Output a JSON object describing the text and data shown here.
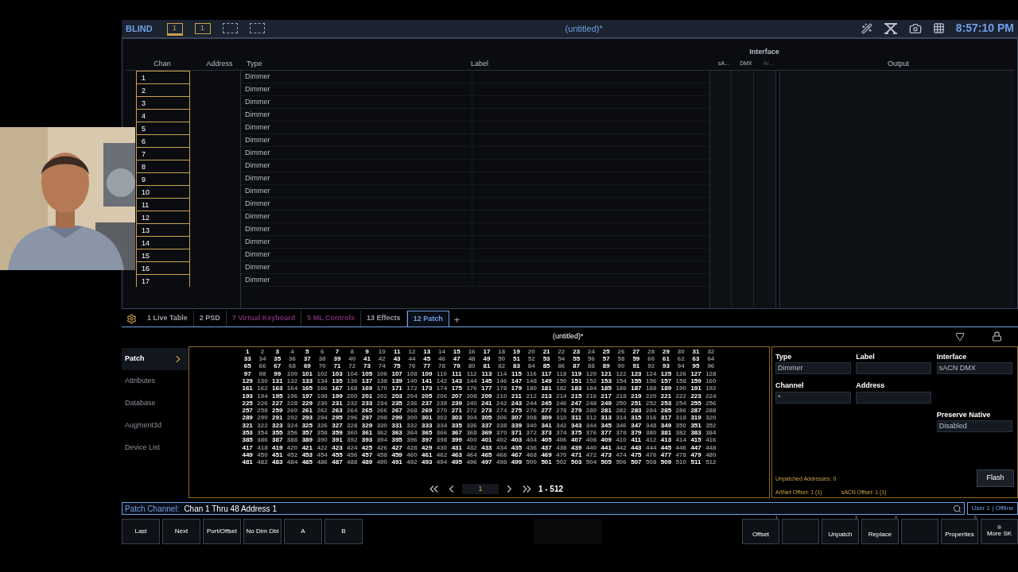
{
  "header": {
    "mode": "BLIND",
    "screens": [
      {
        "kind": "monitor",
        "label": "1"
      },
      {
        "kind": "box",
        "label": "1"
      },
      {
        "kind": "empty"
      },
      {
        "kind": "empty"
      }
    ],
    "title": "(untitled)*",
    "time": "8:57:10 PM"
  },
  "channel_table": {
    "interface_heading": "Interface",
    "columns": {
      "chan": "Chan",
      "address": "Address",
      "type": "Type",
      "label": "Label",
      "interface": [
        "sA...",
        "DMX",
        "Ar..."
      ],
      "output": "Output"
    },
    "rows": [
      {
        "chan": "1",
        "type": "Dimmer"
      },
      {
        "chan": "2",
        "type": "Dimmer"
      },
      {
        "chan": "3",
        "type": "Dimmer"
      },
      {
        "chan": "4",
        "type": "Dimmer"
      },
      {
        "chan": "5",
        "type": "Dimmer"
      },
      {
        "chan": "6",
        "type": "Dimmer"
      },
      {
        "chan": "7",
        "type": "Dimmer"
      },
      {
        "chan": "8",
        "type": "Dimmer"
      },
      {
        "chan": "9",
        "type": "Dimmer"
      },
      {
        "chan": "10",
        "type": "Dimmer"
      },
      {
        "chan": "11",
        "type": "Dimmer"
      },
      {
        "chan": "12",
        "type": "Dimmer"
      },
      {
        "chan": "13",
        "type": "Dimmer"
      },
      {
        "chan": "14",
        "type": "Dimmer"
      },
      {
        "chan": "15",
        "type": "Dimmer"
      },
      {
        "chan": "16",
        "type": "Dimmer"
      },
      {
        "chan": "17",
        "type": "Dimmer"
      }
    ]
  },
  "tabs": [
    {
      "label": "1 Live Table",
      "selected": false,
      "color": "#9aa0a8"
    },
    {
      "label": "2 PSD",
      "selected": false,
      "color": "#9aa0a8"
    },
    {
      "label": "7 Virtual Keyboard",
      "selected": false,
      "color": "#7a2f72"
    },
    {
      "label": "5 ML Controls",
      "selected": false,
      "color": "#7a2f72"
    },
    {
      "label": "13 Effects",
      "selected": false,
      "color": "#9aa0a8"
    },
    {
      "label": "12 Patch",
      "selected": true,
      "color": "#6ea0e6"
    }
  ],
  "add_tab": "+",
  "patch_title": "(untitled)*",
  "sidebar": [
    {
      "label": "Patch",
      "selected": true
    },
    {
      "label": "Attributes",
      "selected": false
    },
    {
      "label": "Database",
      "selected": false
    },
    {
      "label": "Augment3d",
      "selected": false
    },
    {
      "label": "Device List",
      "selected": false
    }
  ],
  "addresses": [
    [
      {
        "n": "1",
        "patched": true
      },
      {
        "n": "2",
        "patched": false
      },
      {
        "n": "3",
        "patched": true
      },
      {
        "n": "4",
        "patched": false
      },
      {
        "n": "5",
        "patched": true
      },
      {
        "n": "6",
        "patched": false
      },
      {
        "n": "7",
        "patched": true
      },
      {
        "n": "8",
        "patched": false
      },
      {
        "n": "9",
        "patched": true
      },
      {
        "n": "10",
        "patched": false
      },
      {
        "n": "11",
        "patched": true
      },
      {
        "n": "12",
        "patched": false
      },
      {
        "n": "13",
        "patched": true
      },
      {
        "n": "14",
        "patched": false
      },
      {
        "n": "15",
        "patched": true
      },
      {
        "n": "16",
        "patched": false
      },
      {
        "n": "17",
        "patched": true
      },
      {
        "n": "18",
        "patched": false
      },
      {
        "n": "19",
        "patched": true
      },
      {
        "n": "20",
        "patched": false
      },
      {
        "n": "21",
        "patched": true
      },
      {
        "n": "22",
        "patched": false
      },
      {
        "n": "23",
        "patched": true
      },
      {
        "n": "24",
        "patched": false
      },
      {
        "n": "25",
        "patched": true
      },
      {
        "n": "26",
        "patched": false
      },
      {
        "n": "27",
        "patched": true
      },
      {
        "n": "28",
        "patched": false
      },
      {
        "n": "29",
        "patched": true
      },
      {
        "n": "30",
        "patched": false
      },
      {
        "n": "31",
        "patched": true
      },
      {
        "n": "32",
        "patched": false
      }
    ],
    [
      {
        "n": "33",
        "patched": true
      },
      {
        "n": "34",
        "patched": false
      },
      {
        "n": "35",
        "patched": true
      },
      {
        "n": "36",
        "patched": false
      },
      {
        "n": "37",
        "patched": true
      },
      {
        "n": "38",
        "patched": false
      },
      {
        "n": "39",
        "patched": true
      },
      {
        "n": "40",
        "patched": false
      },
      {
        "n": "41",
        "patched": true
      },
      {
        "n": "42",
        "patched": false
      },
      {
        "n": "43",
        "patched": true
      },
      {
        "n": "44",
        "patched": false
      },
      {
        "n": "45",
        "patched": true
      },
      {
        "n": "46",
        "patched": false
      },
      {
        "n": "47",
        "patched": true
      },
      {
        "n": "48",
        "patched": false
      },
      {
        "n": "49",
        "patched": true
      },
      {
        "n": "50",
        "patched": false
      },
      {
        "n": "51",
        "patched": true
      },
      {
        "n": "52",
        "patched": false
      },
      {
        "n": "53",
        "patched": true
      },
      {
        "n": "54",
        "patched": false
      },
      {
        "n": "55",
        "patched": true
      },
      {
        "n": "56",
        "patched": false
      },
      {
        "n": "57",
        "patched": true
      },
      {
        "n": "58",
        "patched": false
      },
      {
        "n": "59",
        "patched": true
      },
      {
        "n": "60",
        "patched": false
      },
      {
        "n": "61",
        "patched": true
      },
      {
        "n": "62",
        "patched": false
      },
      {
        "n": "63",
        "patched": true
      },
      {
        "n": "64",
        "patched": false
      }
    ],
    [
      {
        "n": "65",
        "patched": true
      },
      {
        "n": "66",
        "patched": false
      },
      {
        "n": "67",
        "patched": true
      },
      {
        "n": "68",
        "patched": false
      },
      {
        "n": "69",
        "patched": true
      },
      {
        "n": "70",
        "patched": false
      },
      {
        "n": "71",
        "patched": true
      },
      {
        "n": "72",
        "patched": false
      },
      {
        "n": "73",
        "patched": true
      },
      {
        "n": "74",
        "patched": false
      },
      {
        "n": "75",
        "patched": true
      },
      {
        "n": "76",
        "patched": false
      },
      {
        "n": "77",
        "patched": true
      },
      {
        "n": "78",
        "patched": false
      },
      {
        "n": "79",
        "patched": true
      },
      {
        "n": "80",
        "patched": false
      },
      {
        "n": "81",
        "patched": true
      },
      {
        "n": "82",
        "patched": false
      },
      {
        "n": "83",
        "patched": true
      },
      {
        "n": "84",
        "patched": false
      },
      {
        "n": "85",
        "patched": true
      },
      {
        "n": "86",
        "patched": false
      },
      {
        "n": "87",
        "patched": true
      },
      {
        "n": "88",
        "patched": false
      },
      {
        "n": "89",
        "patched": true
      },
      {
        "n": "90",
        "patched": false
      },
      {
        "n": "91",
        "patched": true
      },
      {
        "n": "92",
        "patched": false
      },
      {
        "n": "93",
        "patched": true
      },
      {
        "n": "94",
        "patched": false
      },
      {
        "n": "95",
        "patched": true
      },
      {
        "n": "96",
        "patched": false
      }
    ],
    [
      {
        "n": "97",
        "patched": true
      },
      {
        "n": "98",
        "patched": false
      },
      {
        "n": "99",
        "patched": true
      },
      {
        "n": "100",
        "patched": false
      },
      {
        "n": "101",
        "patched": true
      },
      {
        "n": "102",
        "patched": false
      },
      {
        "n": "103",
        "patched": true
      },
      {
        "n": "104",
        "patched": false
      },
      {
        "n": "105",
        "patched": true
      },
      {
        "n": "106",
        "patched": false
      },
      {
        "n": "107",
        "patched": true
      },
      {
        "n": "108",
        "patched": false
      },
      {
        "n": "109",
        "patched": true
      },
      {
        "n": "110",
        "patched": false
      },
      {
        "n": "111",
        "patched": true
      },
      {
        "n": "112",
        "patched": false
      },
      {
        "n": "113",
        "patched": true
      },
      {
        "n": "114",
        "patched": false
      },
      {
        "n": "115",
        "patched": true
      },
      {
        "n": "116",
        "patched": false
      },
      {
        "n": "117",
        "patched": true
      },
      {
        "n": "118",
        "patched": false
      },
      {
        "n": "119",
        "patched": true
      },
      {
        "n": "120",
        "patched": false
      },
      {
        "n": "121",
        "patched": true
      },
      {
        "n": "122",
        "patched": false
      },
      {
        "n": "123",
        "patched": true
      },
      {
        "n": "124",
        "patched": false
      },
      {
        "n": "125",
        "patched": true
      },
      {
        "n": "126",
        "patched": false
      },
      {
        "n": "127",
        "patched": true
      },
      {
        "n": "128",
        "patched": false
      }
    ],
    [
      {
        "n": "129",
        "patched": true
      },
      {
        "n": "130",
        "patched": false
      },
      {
        "n": "131",
        "patched": true
      },
      {
        "n": "132",
        "patched": false
      },
      {
        "n": "133",
        "patched": true
      },
      {
        "n": "134",
        "patched": false
      },
      {
        "n": "135",
        "patched": true
      },
      {
        "n": "136",
        "patched": false
      },
      {
        "n": "137",
        "patched": true
      },
      {
        "n": "138",
        "patched": false
      },
      {
        "n": "139",
        "patched": true
      },
      {
        "n": "140",
        "patched": false
      },
      {
        "n": "141",
        "patched": true
      },
      {
        "n": "142",
        "patched": false
      },
      {
        "n": "143",
        "patched": true
      },
      {
        "n": "144",
        "patched": false
      },
      {
        "n": "145",
        "patched": true
      },
      {
        "n": "146",
        "patched": false
      },
      {
        "n": "147",
        "patched": true
      },
      {
        "n": "148",
        "patched": false
      },
      {
        "n": "149",
        "patched": true
      },
      {
        "n": "150",
        "patched": false
      },
      {
        "n": "151",
        "patched": true
      },
      {
        "n": "152",
        "patched": false
      },
      {
        "n": "153",
        "patched": true
      },
      {
        "n": "154",
        "patched": false
      },
      {
        "n": "155",
        "patched": true
      },
      {
        "n": "156",
        "patched": false
      },
      {
        "n": "157",
        "patched": true
      },
      {
        "n": "158",
        "patched": false
      },
      {
        "n": "159",
        "patched": true
      },
      {
        "n": "160",
        "patched": false
      }
    ],
    [
      {
        "n": "161",
        "patched": true
      },
      {
        "n": "162",
        "patched": false
      },
      {
        "n": "163",
        "patched": true
      },
      {
        "n": "164",
        "patched": false
      },
      {
        "n": "165",
        "patched": true
      },
      {
        "n": "166",
        "patched": false
      },
      {
        "n": "167",
        "patched": true
      },
      {
        "n": "168",
        "patched": false
      },
      {
        "n": "169",
        "patched": true
      },
      {
        "n": "170",
        "patched": false
      },
      {
        "n": "171",
        "patched": true
      },
      {
        "n": "172",
        "patched": false
      },
      {
        "n": "173",
        "patched": true
      },
      {
        "n": "174",
        "patched": false
      },
      {
        "n": "175",
        "patched": true
      },
      {
        "n": "176",
        "patched": false
      },
      {
        "n": "177",
        "patched": true
      },
      {
        "n": "178",
        "patched": false
      },
      {
        "n": "179",
        "patched": true
      },
      {
        "n": "180",
        "patched": false
      },
      {
        "n": "181",
        "patched": true
      },
      {
        "n": "182",
        "patched": false
      },
      {
        "n": "183",
        "patched": true
      },
      {
        "n": "184",
        "patched": false
      },
      {
        "n": "185",
        "patched": true
      },
      {
        "n": "186",
        "patched": false
      },
      {
        "n": "187",
        "patched": true
      },
      {
        "n": "188",
        "patched": false
      },
      {
        "n": "189",
        "patched": true
      },
      {
        "n": "190",
        "patched": false
      },
      {
        "n": "191",
        "patched": true
      },
      {
        "n": "192",
        "patched": false
      }
    ],
    [
      {
        "n": "193",
        "patched": true
      },
      {
        "n": "194",
        "patched": false
      },
      {
        "n": "195",
        "patched": true
      },
      {
        "n": "196",
        "patched": false
      },
      {
        "n": "197",
        "patched": true
      },
      {
        "n": "198",
        "patched": false
      },
      {
        "n": "199",
        "patched": true
      },
      {
        "n": "200",
        "patched": false
      },
      {
        "n": "201",
        "patched": true
      },
      {
        "n": "202",
        "patched": false
      },
      {
        "n": "203",
        "patched": true
      },
      {
        "n": "204",
        "patched": false
      },
      {
        "n": "205",
        "patched": true
      },
      {
        "n": "206",
        "patched": false
      },
      {
        "n": "207",
        "patched": true
      },
      {
        "n": "208",
        "patched": false
      },
      {
        "n": "209",
        "patched": true
      },
      {
        "n": "210",
        "patched": false
      },
      {
        "n": "211",
        "patched": true
      },
      {
        "n": "212",
        "patched": false
      },
      {
        "n": "213",
        "patched": true
      },
      {
        "n": "214",
        "patched": false
      },
      {
        "n": "215",
        "patched": true
      },
      {
        "n": "216",
        "patched": false
      },
      {
        "n": "217",
        "patched": true
      },
      {
        "n": "218",
        "patched": false
      },
      {
        "n": "219",
        "patched": true
      },
      {
        "n": "220",
        "patched": false
      },
      {
        "n": "221",
        "patched": true
      },
      {
        "n": "222",
        "patched": false
      },
      {
        "n": "223",
        "patched": true
      },
      {
        "n": "224",
        "patched": false
      }
    ],
    [
      {
        "n": "225",
        "patched": true
      },
      {
        "n": "226",
        "patched": false
      },
      {
        "n": "227",
        "patched": true
      },
      {
        "n": "228",
        "patched": false
      },
      {
        "n": "229",
        "patched": true
      },
      {
        "n": "230",
        "patched": false
      },
      {
        "n": "231",
        "patched": true
      },
      {
        "n": "232",
        "patched": false
      },
      {
        "n": "233",
        "patched": true
      },
      {
        "n": "234",
        "patched": false
      },
      {
        "n": "235",
        "patched": true
      },
      {
        "n": "236",
        "patched": false
      },
      {
        "n": "237",
        "patched": true
      },
      {
        "n": "238",
        "patched": false
      },
      {
        "n": "239",
        "patched": true
      },
      {
        "n": "240",
        "patched": false
      },
      {
        "n": "241",
        "patched": true
      },
      {
        "n": "242",
        "patched": false
      },
      {
        "n": "243",
        "patched": true
      },
      {
        "n": "244",
        "patched": false
      },
      {
        "n": "245",
        "patched": true
      },
      {
        "n": "246",
        "patched": false
      },
      {
        "n": "247",
        "patched": true
      },
      {
        "n": "248",
        "patched": false
      },
      {
        "n": "249",
        "patched": true
      },
      {
        "n": "250",
        "patched": false
      },
      {
        "n": "251",
        "patched": true
      },
      {
        "n": "252",
        "patched": false
      },
      {
        "n": "253",
        "patched": true
      },
      {
        "n": "254",
        "patched": false
      },
      {
        "n": "255",
        "patched": true
      },
      {
        "n": "256",
        "patched": false
      }
    ],
    [
      {
        "n": "257",
        "patched": true
      },
      {
        "n": "258",
        "patched": false
      },
      {
        "n": "259",
        "patched": true
      },
      {
        "n": "260",
        "patched": false
      },
      {
        "n": "261",
        "patched": true
      },
      {
        "n": "262",
        "patched": false
      },
      {
        "n": "263",
        "patched": true
      },
      {
        "n": "264",
        "patched": false
      },
      {
        "n": "265",
        "patched": true
      },
      {
        "n": "266",
        "patched": false
      },
      {
        "n": "267",
        "patched": true
      },
      {
        "n": "268",
        "patched": false
      },
      {
        "n": "269",
        "patched": true
      },
      {
        "n": "270",
        "patched": false
      },
      {
        "n": "271",
        "patched": true
      },
      {
        "n": "272",
        "patched": false
      },
      {
        "n": "273",
        "patched": true
      },
      {
        "n": "274",
        "patched": false
      },
      {
        "n": "275",
        "patched": true
      },
      {
        "n": "276",
        "patched": false
      },
      {
        "n": "277",
        "patched": true
      },
      {
        "n": "278",
        "patched": false
      },
      {
        "n": "279",
        "patched": true
      },
      {
        "n": "280",
        "patched": false
      },
      {
        "n": "281",
        "patched": true
      },
      {
        "n": "282",
        "patched": false
      },
      {
        "n": "283",
        "patched": true
      },
      {
        "n": "284",
        "patched": false
      },
      {
        "n": "285",
        "patched": true
      },
      {
        "n": "286",
        "patched": false
      },
      {
        "n": "287",
        "patched": true
      },
      {
        "n": "288",
        "patched": false
      }
    ],
    [
      {
        "n": "289",
        "patched": true
      },
      {
        "n": "290",
        "patched": false
      },
      {
        "n": "291",
        "patched": true
      },
      {
        "n": "292",
        "patched": false
      },
      {
        "n": "293",
        "patched": true
      },
      {
        "n": "294",
        "patched": false
      },
      {
        "n": "295",
        "patched": true
      },
      {
        "n": "296",
        "patched": false
      },
      {
        "n": "297",
        "patched": true
      },
      {
        "n": "298",
        "patched": false
      },
      {
        "n": "299",
        "patched": true
      },
      {
        "n": "300",
        "patched": false
      },
      {
        "n": "301",
        "patched": true
      },
      {
        "n": "302",
        "patched": false
      },
      {
        "n": "303",
        "patched": true
      },
      {
        "n": "304",
        "patched": false
      },
      {
        "n": "305",
        "patched": true
      },
      {
        "n": "306",
        "patched": false
      },
      {
        "n": "307",
        "patched": true
      },
      {
        "n": "308",
        "patched": false
      },
      {
        "n": "309",
        "patched": true
      },
      {
        "n": "310",
        "patched": false
      },
      {
        "n": "311",
        "patched": true
      },
      {
        "n": "312",
        "patched": false
      },
      {
        "n": "313",
        "patched": true
      },
      {
        "n": "314",
        "patched": false
      },
      {
        "n": "315",
        "patched": true
      },
      {
        "n": "316",
        "patched": false
      },
      {
        "n": "317",
        "patched": true
      },
      {
        "n": "318",
        "patched": false
      },
      {
        "n": "319",
        "patched": true
      },
      {
        "n": "320",
        "patched": false
      }
    ],
    [
      {
        "n": "321",
        "patched": true
      },
      {
        "n": "322",
        "patched": false
      },
      {
        "n": "323",
        "patched": true
      },
      {
        "n": "324",
        "patched": false
      },
      {
        "n": "325",
        "patched": true
      },
      {
        "n": "326",
        "patched": false
      },
      {
        "n": "327",
        "patched": true
      },
      {
        "n": "328",
        "patched": false
      },
      {
        "n": "329",
        "patched": true
      },
      {
        "n": "330",
        "patched": false
      },
      {
        "n": "331",
        "patched": true
      },
      {
        "n": "332",
        "patched": false
      },
      {
        "n": "333",
        "patched": true
      },
      {
        "n": "334",
        "patched": false
      },
      {
        "n": "335",
        "patched": true
      },
      {
        "n": "336",
        "patched": false
      },
      {
        "n": "337",
        "patched": true
      },
      {
        "n": "338",
        "patched": false
      },
      {
        "n": "339",
        "patched": true
      },
      {
        "n": "340",
        "patched": false
      },
      {
        "n": "341",
        "patched": true
      },
      {
        "n": "342",
        "patched": false
      },
      {
        "n": "343",
        "patched": true
      },
      {
        "n": "344",
        "patched": false
      },
      {
        "n": "345",
        "patched": true
      },
      {
        "n": "346",
        "patched": false
      },
      {
        "n": "347",
        "patched": true
      },
      {
        "n": "348",
        "patched": false
      },
      {
        "n": "349",
        "patched": true
      },
      {
        "n": "350",
        "patched": false
      },
      {
        "n": "351",
        "patched": true
      },
      {
        "n": "352",
        "patched": false
      }
    ],
    [
      {
        "n": "353",
        "patched": true
      },
      {
        "n": "354",
        "patched": false
      },
      {
        "n": "355",
        "patched": true
      },
      {
        "n": "356",
        "patched": false
      },
      {
        "n": "357",
        "patched": true
      },
      {
        "n": "358",
        "patched": false
      },
      {
        "n": "359",
        "patched": true
      },
      {
        "n": "360",
        "patched": false
      },
      {
        "n": "361",
        "patched": true
      },
      {
        "n": "362",
        "patched": false
      },
      {
        "n": "363",
        "patched": true
      },
      {
        "n": "364",
        "patched": false
      },
      {
        "n": "365",
        "patched": true
      },
      {
        "n": "366",
        "patched": false
      },
      {
        "n": "367",
        "patched": true
      },
      {
        "n": "368",
        "patched": false
      },
      {
        "n": "369",
        "patched": true
      },
      {
        "n": "370",
        "patched": false
      },
      {
        "n": "371",
        "patched": true
      },
      {
        "n": "372",
        "patched": false
      },
      {
        "n": "373",
        "patched": true
      },
      {
        "n": "374",
        "patched": false
      },
      {
        "n": "375",
        "patched": true
      },
      {
        "n": "376",
        "patched": false
      },
      {
        "n": "377",
        "patched": true
      },
      {
        "n": "378",
        "patched": false
      },
      {
        "n": "379",
        "patched": true
      },
      {
        "n": "380",
        "patched": false
      },
      {
        "n": "381",
        "patched": true
      },
      {
        "n": "382",
        "patched": false
      },
      {
        "n": "383",
        "patched": true
      },
      {
        "n": "384",
        "patched": false
      }
    ],
    [
      {
        "n": "385",
        "patched": true
      },
      {
        "n": "386",
        "patched": false
      },
      {
        "n": "387",
        "patched": true
      },
      {
        "n": "388",
        "patched": false
      },
      {
        "n": "389",
        "patched": true
      },
      {
        "n": "390",
        "patched": false
      },
      {
        "n": "391",
        "patched": true
      },
      {
        "n": "392",
        "patched": false
      },
      {
        "n": "393",
        "patched": true
      },
      {
        "n": "394",
        "patched": false
      },
      {
        "n": "395",
        "patched": true
      },
      {
        "n": "396",
        "patched": false
      },
      {
        "n": "397",
        "patched": true
      },
      {
        "n": "398",
        "patched": false
      },
      {
        "n": "399",
        "patched": true
      },
      {
        "n": "400",
        "patched": false
      },
      {
        "n": "401",
        "patched": true
      },
      {
        "n": "402",
        "patched": false
      },
      {
        "n": "403",
        "patched": true
      },
      {
        "n": "404",
        "patched": false
      },
      {
        "n": "405",
        "patched": true
      },
      {
        "n": "406",
        "patched": false
      },
      {
        "n": "407",
        "patched": true
      },
      {
        "n": "408",
        "patched": false
      },
      {
        "n": "409",
        "patched": true
      },
      {
        "n": "410",
        "patched": false
      },
      {
        "n": "411",
        "patched": true
      },
      {
        "n": "412",
        "patched": false
      },
      {
        "n": "413",
        "patched": true
      },
      {
        "n": "414",
        "patched": false
      },
      {
        "n": "415",
        "patched": true
      },
      {
        "n": "416",
        "patched": false
      }
    ],
    [
      {
        "n": "417",
        "patched": true
      },
      {
        "n": "418",
        "patched": false
      },
      {
        "n": "419",
        "patched": true
      },
      {
        "n": "420",
        "patched": false
      },
      {
        "n": "421",
        "patched": true
      },
      {
        "n": "422",
        "patched": false
      },
      {
        "n": "423",
        "patched": true
      },
      {
        "n": "424",
        "patched": false
      },
      {
        "n": "425",
        "patched": true
      },
      {
        "n": "426",
        "patched": false
      },
      {
        "n": "427",
        "patched": true
      },
      {
        "n": "428",
        "patched": false
      },
      {
        "n": "429",
        "patched": true
      },
      {
        "n": "430",
        "patched": false
      },
      {
        "n": "431",
        "patched": true
      },
      {
        "n": "432",
        "patched": false
      },
      {
        "n": "433",
        "patched": true
      },
      {
        "n": "434",
        "patched": false
      },
      {
        "n": "435",
        "patched": true
      },
      {
        "n": "436",
        "patched": false
      },
      {
        "n": "437",
        "patched": true
      },
      {
        "n": "438",
        "patched": false
      },
      {
        "n": "439",
        "patched": true
      },
      {
        "n": "440",
        "patched": false
      },
      {
        "n": "441",
        "patched": true
      },
      {
        "n": "442",
        "patched": false
      },
      {
        "n": "443",
        "patched": true
      },
      {
        "n": "444",
        "patched": false
      },
      {
        "n": "445",
        "patched": true
      },
      {
        "n": "446",
        "patched": false
      },
      {
        "n": "447",
        "patched": true
      },
      {
        "n": "448",
        "patched": false
      }
    ],
    [
      {
        "n": "449",
        "patched": true
      },
      {
        "n": "450",
        "patched": false
      },
      {
        "n": "451",
        "patched": true
      },
      {
        "n": "452",
        "patched": false
      },
      {
        "n": "453",
        "patched": true
      },
      {
        "n": "454",
        "patched": false
      },
      {
        "n": "455",
        "patched": true
      },
      {
        "n": "456",
        "patched": false
      },
      {
        "n": "457",
        "patched": true
      },
      {
        "n": "458",
        "patched": false
      },
      {
        "n": "459",
        "patched": true
      },
      {
        "n": "460",
        "patched": false
      },
      {
        "n": "461",
        "patched": true
      },
      {
        "n": "462",
        "patched": false
      },
      {
        "n": "463",
        "patched": true
      },
      {
        "n": "464",
        "patched": false
      },
      {
        "n": "465",
        "patched": true
      },
      {
        "n": "466",
        "patched": false
      },
      {
        "n": "467",
        "patched": true
      },
      {
        "n": "468",
        "patched": false
      },
      {
        "n": "469",
        "patched": true
      },
      {
        "n": "470",
        "patched": false
      },
      {
        "n": "471",
        "patched": true
      },
      {
        "n": "472",
        "patched": false
      },
      {
        "n": "473",
        "patched": true
      },
      {
        "n": "474",
        "patched": false
      },
      {
        "n": "475",
        "patched": true
      },
      {
        "n": "476",
        "patched": false
      },
      {
        "n": "477",
        "patched": true
      },
      {
        "n": "478",
        "patched": false
      },
      {
        "n": "479",
        "patched": true
      },
      {
        "n": "480",
        "patched": false
      }
    ],
    [
      {
        "n": "481",
        "patched": true
      },
      {
        "n": "482",
        "patched": false
      },
      {
        "n": "483",
        "patched": true
      },
      {
        "n": "484",
        "patched": false
      },
      {
        "n": "485",
        "patched": true
      },
      {
        "n": "486",
        "patched": false
      },
      {
        "n": "487",
        "patched": true
      },
      {
        "n": "488",
        "patched": false
      },
      {
        "n": "489",
        "patched": true
      },
      {
        "n": "490",
        "patched": false
      },
      {
        "n": "491",
        "patched": true
      },
      {
        "n": "492",
        "patched": false
      },
      {
        "n": "493",
        "patched": true
      },
      {
        "n": "494",
        "patched": false
      },
      {
        "n": "495",
        "patched": true
      },
      {
        "n": "496",
        "patched": false
      },
      {
        "n": "497",
        "patched": true
      },
      {
        "n": "498",
        "patched": false
      },
      {
        "n": "499",
        "patched": true
      },
      {
        "n": "500",
        "patched": false
      },
      {
        "n": "501",
        "patched": true
      },
      {
        "n": "502",
        "patched": false
      },
      {
        "n": "503",
        "patched": true
      },
      {
        "n": "504",
        "patched": false
      },
      {
        "n": "505",
        "patched": true
      },
      {
        "n": "506",
        "patched": false
      },
      {
        "n": "507",
        "patched": true
      },
      {
        "n": "508",
        "patched": false
      },
      {
        "n": "509",
        "patched": true
      },
      {
        "n": "510",
        "patched": false
      },
      {
        "n": "511",
        "patched": true
      },
      {
        "n": "512",
        "patched": false
      }
    ]
  ],
  "pager": {
    "page": "1",
    "range": "1 - 512"
  },
  "properties": {
    "fields": [
      {
        "label": "Type",
        "value": "Dimmer"
      },
      {
        "label": "Label"
      },
      {
        "label": "Interface",
        "value": "sACN DMX"
      },
      {
        "label": "Channel",
        "value": "*"
      },
      {
        "label": "Address"
      },
      {
        "label": "Preserve Native",
        "value": "Disabled"
      }
    ],
    "unpatched": "Unpatched Addresses: 0",
    "flash": "Flash",
    "artnet_offset": "ArtNet Offset: 1 (1)",
    "sacn_offset": "sACN Offset: 1 (1)"
  },
  "command_line": {
    "prompt": "Patch Channel:",
    "text": "Chan 1 Thru 48 Address 1",
    "user": "User 1 | Offline"
  },
  "softkeys_left": [
    {
      "kind": "key",
      "label": "Last"
    },
    {
      "kind": "key",
      "label": "Next"
    },
    {
      "kind": "key",
      "label": "Port/Offset"
    },
    {
      "kind": "key",
      "label": "No Dim Dbl"
    },
    {
      "kind": "key",
      "label": "A"
    },
    {
      "kind": "key",
      "label": "B"
    }
  ],
  "softkeys_right": [
    {
      "kind": "key",
      "label": "Offset",
      "index": "1"
    },
    {
      "kind": "blank"
    },
    {
      "kind": "key",
      "label": "Unpatch",
      "index": "3"
    },
    {
      "kind": "key",
      "label": "Replace",
      "index": "4"
    },
    {
      "kind": "blank"
    },
    {
      "kind": "key",
      "label": "Properties",
      "index": "6"
    },
    {
      "kind": "more",
      "label": "More SK"
    }
  ]
}
